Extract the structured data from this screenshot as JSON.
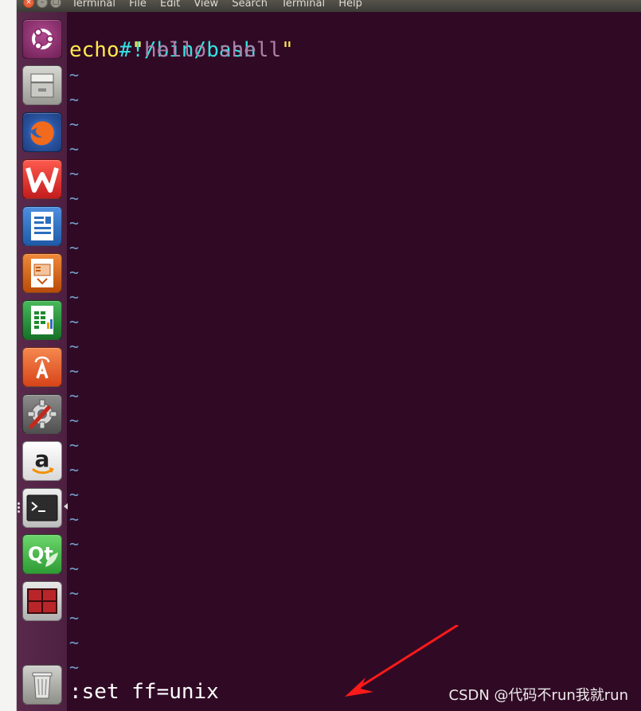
{
  "menubar": {
    "items": [
      "Terminal",
      "File",
      "Edit",
      "View",
      "Search",
      "Terminal",
      "Help"
    ],
    "close_glyph": "×",
    "min_glyph": "–",
    "max_glyph": "□"
  },
  "launcher": {
    "items": [
      {
        "name": "ubuntu-dash-icon",
        "color": "#8b2a6a"
      },
      {
        "name": "files-icon",
        "color": "#9a9a94"
      },
      {
        "name": "firefox-icon",
        "color": "#e66000"
      },
      {
        "name": "wps-office-icon",
        "color": "#d9262d"
      },
      {
        "name": "libreoffice-writer-icon",
        "color": "#2a6dbf"
      },
      {
        "name": "libreoffice-impress-icon",
        "color": "#c2560e"
      },
      {
        "name": "libreoffice-calc-icon",
        "color": "#1f8a2e"
      },
      {
        "name": "software-center-icon",
        "color": "#e95420"
      },
      {
        "name": "system-settings-icon",
        "color": "#6f6f6f"
      },
      {
        "name": "amazon-icon",
        "color": "#f0f0f0"
      },
      {
        "name": "terminal-icon",
        "color": "#2c2c2c"
      },
      {
        "name": "qt-creator-icon",
        "color": "#41cd52"
      },
      {
        "name": "workspace-switcher-icon",
        "color": "#7a1c1c"
      }
    ],
    "trash": {
      "name": "trash-icon",
      "color": "#9b9b95"
    }
  },
  "editor": {
    "line1": "#!/bin/bash",
    "line2_kw": "echo",
    "line2_quote_open": "\"",
    "line2_str": "hello shell",
    "line2_quote_close": "\"",
    "tilde": "~",
    "command": ":set ff=unix"
  },
  "watermark": "CSDN @代码不run我就run",
  "colors": {
    "terminal_bg": "#300a24",
    "shebang": "#34e2e2",
    "keyword": "#fce94f",
    "string": "#ad7fa8",
    "tilde": "#729fcf",
    "annotation_arrow": "#ff1a1a"
  }
}
